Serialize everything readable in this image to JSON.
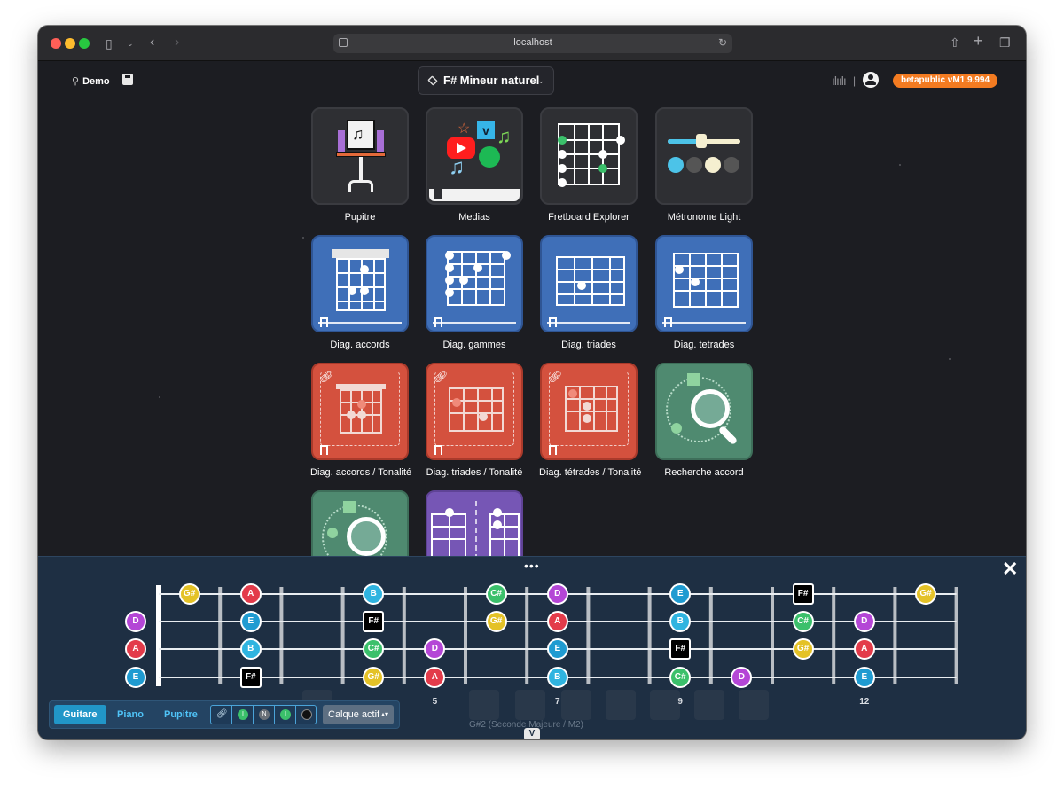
{
  "browser": {
    "url": "localhost"
  },
  "header": {
    "project": "Demo",
    "scale": "F# Mineur naturel",
    "version": "betapublic vM1.9.994"
  },
  "tiles": [
    {
      "label": "Pupitre"
    },
    {
      "label": "Medias"
    },
    {
      "label": "Fretboard Explorer"
    },
    {
      "label": "Métronome Light"
    },
    {
      "label": "Diag. accords"
    },
    {
      "label": "Diag. gammes"
    },
    {
      "label": "Diag. triades"
    },
    {
      "label": "Diag. tetrades"
    },
    {
      "label": "Diag. accords / Tonalité"
    },
    {
      "label": "Diag. triades / Tonalité"
    },
    {
      "label": "Diag. tétrades / Tonalité"
    },
    {
      "label": "Recherche accord"
    }
  ],
  "fretboard": {
    "note_colors": {
      "E": "#1f9bd1",
      "F#": "#000000",
      "G#": "#e4c227",
      "A": "#e33b4a",
      "B": "#2fb4e0",
      "C#": "#3bc06b",
      "D": "#b446d6"
    },
    "strings": [
      {
        "open": "",
        "notes": [
          {
            "fret": 1,
            "note": "G#"
          },
          {
            "fret": 2,
            "note": "A"
          },
          {
            "fret": 4,
            "note": "B"
          },
          {
            "fret": 6,
            "note": "C#"
          },
          {
            "fret": 7,
            "note": "D"
          },
          {
            "fret": 9,
            "note": "E"
          },
          {
            "fret": 11,
            "note": "F#"
          },
          {
            "fret": 13,
            "note": "G#"
          }
        ]
      },
      {
        "open": "D",
        "notes": [
          {
            "fret": 2,
            "note": "E"
          },
          {
            "fret": 4,
            "note": "F#"
          },
          {
            "fret": 6,
            "note": "G#"
          },
          {
            "fret": 7,
            "note": "A"
          },
          {
            "fret": 9,
            "note": "B"
          },
          {
            "fret": 11,
            "note": "C#"
          },
          {
            "fret": 12,
            "note": "D"
          }
        ]
      },
      {
        "open": "A",
        "notes": [
          {
            "fret": 2,
            "note": "B"
          },
          {
            "fret": 4,
            "note": "C#"
          },
          {
            "fret": 5,
            "note": "D"
          },
          {
            "fret": 7,
            "note": "E"
          },
          {
            "fret": 9,
            "note": "F#"
          },
          {
            "fret": 11,
            "note": "G#"
          },
          {
            "fret": 12,
            "note": "A"
          }
        ]
      },
      {
        "open": "E",
        "notes": [
          {
            "fret": 2,
            "note": "F#"
          },
          {
            "fret": 4,
            "note": "G#"
          },
          {
            "fret": 5,
            "note": "A"
          },
          {
            "fret": 7,
            "note": "B"
          },
          {
            "fret": 9,
            "note": "C#"
          },
          {
            "fret": 10,
            "note": "D"
          },
          {
            "fret": 12,
            "note": "E"
          }
        ]
      }
    ],
    "fret_numbers": [
      {
        "fret": 5,
        "label": "5"
      },
      {
        "fret": 7,
        "label": "7"
      },
      {
        "fret": 9,
        "label": "9"
      },
      {
        "fret": 12,
        "label": "12"
      }
    ]
  },
  "toolbar": {
    "guitar": "Guitare",
    "piano": "Piano",
    "pupitre": "Pupitre",
    "layer": "Calque actif",
    "seg_labels": [
      "I",
      "N",
      "I"
    ]
  },
  "status": "G#2 (Seconde Majeure / M2)"
}
